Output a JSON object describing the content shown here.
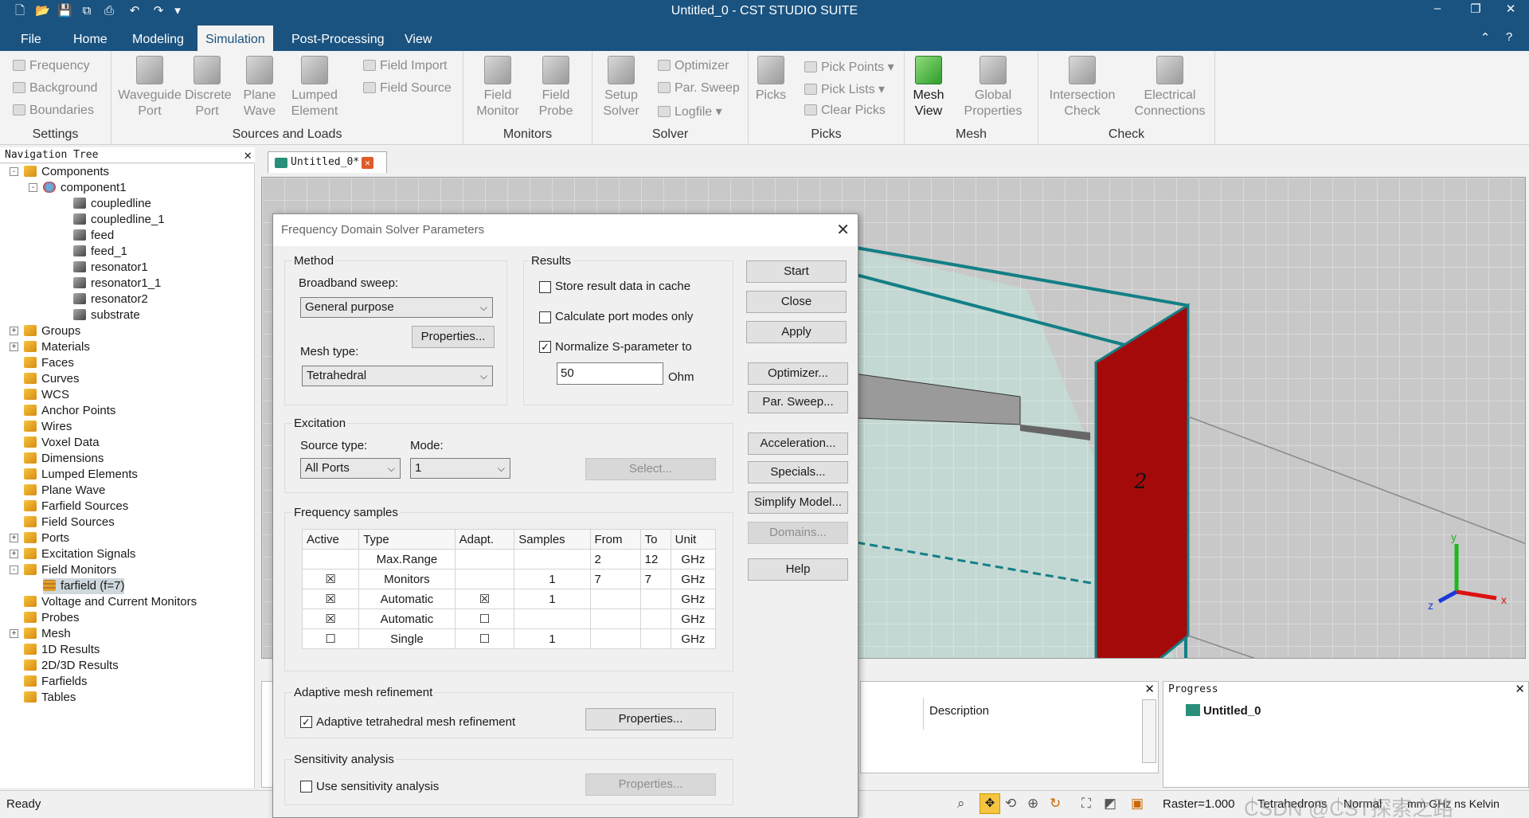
{
  "app": {
    "title": "Untitled_0 - CST STUDIO SUITE"
  },
  "menu": {
    "tabs": [
      "File",
      "Home",
      "Modeling",
      "Simulation",
      "Post-Processing",
      "View"
    ],
    "active": "Simulation"
  },
  "ribbon": {
    "settings": {
      "label": "Settings",
      "items": [
        "Frequency",
        "Background",
        "Boundaries"
      ]
    },
    "sources": {
      "label": "Sources and Loads",
      "big": [
        "Waveguide Port",
        "Discrete Port",
        "Plane Wave",
        "Lumped Element"
      ],
      "small": [
        "Field Import",
        "Field Source"
      ]
    },
    "monitors": {
      "label": "Monitors",
      "big": [
        "Field Monitor",
        "Field Probe"
      ]
    },
    "solver": {
      "label": "Solver",
      "big": "Setup Solver",
      "small": [
        "Optimizer",
        "Par. Sweep",
        "Logfile"
      ]
    },
    "picks": {
      "label": "Picks",
      "big": "Picks",
      "small": [
        "Pick Points",
        "Pick Lists",
        "Clear Picks"
      ]
    },
    "mesh": {
      "label": "Mesh",
      "big": [
        "Mesh View",
        "Global Properties"
      ]
    },
    "check": {
      "label": "Check",
      "big": [
        "Intersection Check",
        "Electrical Connections"
      ]
    }
  },
  "nav": {
    "title": "Navigation Tree",
    "items": [
      "Components",
      "component1",
      "coupledline",
      "coupledline_1",
      "feed",
      "feed_1",
      "resonator1",
      "resonator1_1",
      "resonator2",
      "substrate",
      "Groups",
      "Materials",
      "Faces",
      "Curves",
      "WCS",
      "Anchor Points",
      "Wires",
      "Voxel Data",
      "Dimensions",
      "Lumped Elements",
      "Plane Wave",
      "Farfield Sources",
      "Field Sources",
      "Ports",
      "Excitation Signals",
      "Field Monitors",
      "farfield (f=7)",
      "Voltage and Current Monitors",
      "Probes",
      "Mesh",
      "1D Results",
      "2D/3D Results",
      "Farfields",
      "Tables"
    ]
  },
  "doc_tab": "Untitled_0*",
  "viewport": {
    "port_label": "2",
    "axes": {
      "x": "x",
      "y": "y",
      "z": "z"
    }
  },
  "dialog": {
    "title": "Frequency Domain Solver Parameters",
    "method": {
      "label": "Method",
      "broadband_label": "Broadband sweep:",
      "broadband_value": "General purpose",
      "properties": "Properties...",
      "mesh_label": "Mesh type:",
      "mesh_value": "Tetrahedral"
    },
    "results": {
      "label": "Results",
      "store": "Store result data in cache",
      "calc": "Calculate port modes only",
      "normalize": "Normalize S-parameter to",
      "impedance": "50",
      "unit": "Ohm"
    },
    "buttons": [
      "Start",
      "Close",
      "Apply",
      "Optimizer...",
      "Par. Sweep...",
      "Acceleration...",
      "Specials...",
      "Simplify Model...",
      "Domains...",
      "Help"
    ],
    "excitation": {
      "label": "Excitation",
      "source_label": "Source type:",
      "source_value": "All Ports",
      "mode_label": "Mode:",
      "mode_value": "1",
      "select": "Select..."
    },
    "freq": {
      "label": "Frequency samples",
      "headers": [
        "Active",
        "Type",
        "Adapt.",
        "Samples",
        "From",
        "To",
        "Unit"
      ],
      "rows": [
        {
          "active": "",
          "type": "Max.Range",
          "adapt": "",
          "samples": "",
          "from": "2",
          "to": "12",
          "unit": "GHz"
        },
        {
          "active": "☒",
          "type": "Monitors",
          "adapt": "",
          "samples": "1",
          "from": "7",
          "to": "7",
          "unit": "GHz"
        },
        {
          "active": "☒",
          "type": "Automatic",
          "adapt": "☒",
          "samples": "1",
          "from": "",
          "to": "",
          "unit": "GHz"
        },
        {
          "active": "☒",
          "type": "Automatic",
          "adapt": "☐",
          "samples": "",
          "from": "",
          "to": "",
          "unit": "GHz"
        },
        {
          "active": "☐",
          "type": "Single",
          "adapt": "☐",
          "samples": "1",
          "from": "",
          "to": "",
          "unit": "GHz"
        }
      ]
    },
    "adaptive": {
      "label": "Adaptive mesh refinement",
      "check": "Adaptive tetrahedral mesh refinement",
      "properties": "Properties..."
    },
    "sensitivity": {
      "label": "Sensitivity analysis",
      "check": "Use sensitivity analysis",
      "properties": "Properties..."
    }
  },
  "panels": {
    "description": "Description",
    "progress": "Progress",
    "progress_item": "Untitled_0"
  },
  "status": {
    "ready": "Ready",
    "raster": "Raster=1.000",
    "mesh": "Tetrahedrons",
    "mode": "Normal",
    "units": "mm GHz ns Kelvin",
    "watermark": "CSDN @CST探索之路"
  },
  "colors": {
    "accent": "#1a5380",
    "port": "#a50a0a",
    "substrate": "#9ed8c8",
    "edge": "#137f86"
  }
}
